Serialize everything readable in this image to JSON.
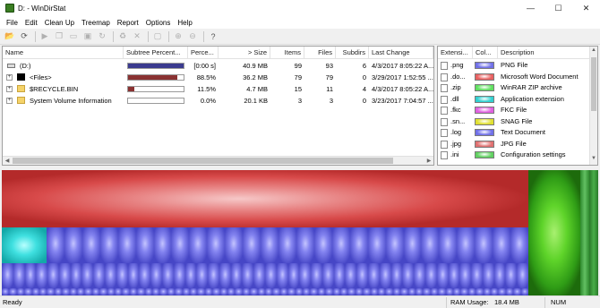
{
  "window": {
    "title": "D: - WinDirStat",
    "minimize": "—",
    "maximize": "☐",
    "close": "✕"
  },
  "menu": [
    "File",
    "Edit",
    "Clean Up",
    "Treemap",
    "Report",
    "Options",
    "Help"
  ],
  "toolbar": [
    {
      "icon": "open-folder-icon",
      "glyph": "📂",
      "enabled": true
    },
    {
      "icon": "refresh-icon",
      "glyph": "⟳",
      "enabled": true
    },
    {
      "sep": true
    },
    {
      "icon": "play-icon",
      "glyph": "▶",
      "enabled": false
    },
    {
      "icon": "copy-icon",
      "glyph": "❐",
      "enabled": false
    },
    {
      "icon": "explorer-icon",
      "glyph": "▭",
      "enabled": false
    },
    {
      "icon": "command-prompt-icon",
      "glyph": "▣",
      "enabled": false
    },
    {
      "icon": "reload-icon",
      "glyph": "↻",
      "enabled": false
    },
    {
      "sep": true
    },
    {
      "icon": "recycle-icon",
      "glyph": "♻",
      "enabled": false
    },
    {
      "icon": "delete-icon",
      "glyph": "✕",
      "enabled": false
    },
    {
      "sep": true
    },
    {
      "icon": "new-folder-icon",
      "glyph": "▢",
      "enabled": false
    },
    {
      "sep": true
    },
    {
      "icon": "zoom-in-icon",
      "glyph": "⊕",
      "enabled": false
    },
    {
      "icon": "zoom-out-icon",
      "glyph": "⊖",
      "enabled": false
    },
    {
      "sep": true
    },
    {
      "icon": "help-icon",
      "glyph": "?",
      "enabled": true
    }
  ],
  "tree": {
    "columns": [
      "Name",
      "Subtree Percent...",
      "Perce...",
      "> Size",
      "Items",
      "Files",
      "Subdirs",
      "Last Change"
    ],
    "rows": [
      {
        "name": "(D:)",
        "icon": "drive-icon",
        "expander": "",
        "subtree_fraction": 1.0,
        "subtree_color": "#3b3b8f",
        "percent": "[0:00 s]",
        "size": "40.9 MB",
        "items": "99",
        "files": "93",
        "subdirs": "6",
        "last_change": "4/3/2017  8:05:22 A..."
      },
      {
        "name": "<Files>",
        "icon": "files-icon",
        "expander": "+",
        "subtree_fraction": 0.885,
        "subtree_color": "#8a3232",
        "percent": "88.5%",
        "size": "36.2 MB",
        "items": "79",
        "files": "79",
        "subdirs": "0",
        "last_change": "3/29/2017  1:52:55 ..."
      },
      {
        "name": "$RECYCLE.BIN",
        "icon": "folder-icon",
        "expander": "+",
        "subtree_fraction": 0.115,
        "subtree_color": "#8a3232",
        "percent": "11.5%",
        "size": "4.7 MB",
        "items": "15",
        "files": "11",
        "subdirs": "4",
        "last_change": "4/3/2017  8:05:22 A..."
      },
      {
        "name": "System Volume Information",
        "icon": "folder-icon",
        "expander": "+",
        "subtree_fraction": 0.0,
        "subtree_color": "#8a3232",
        "percent": "0.0%",
        "size": "20.1 KB",
        "items": "3",
        "files": "3",
        "subdirs": "0",
        "last_change": "3/23/2017  7:04:57 ..."
      }
    ]
  },
  "extensions": {
    "columns": [
      "Extensi...",
      "Col...",
      "Description"
    ],
    "rows": [
      {
        "ext": ".png",
        "color": "#7070e8",
        "desc": "PNG File"
      },
      {
        "ext": ".do...",
        "color": "#e86060",
        "desc": "Microsoft Word Document"
      },
      {
        "ext": ".zip",
        "color": "#60e060",
        "desc": "WinRAR ZIP archive"
      },
      {
        "ext": ".dll",
        "color": "#30d0d0",
        "desc": "Application extension"
      },
      {
        "ext": ".fkc",
        "color": "#e060e0",
        "desc": "FKC File"
      },
      {
        "ext": ".sn...",
        "color": "#e0e030",
        "desc": "SNAG File"
      },
      {
        "ext": ".log",
        "color": "#7070e8",
        "desc": "Text Document"
      },
      {
        "ext": ".jpg",
        "color": "#e07070",
        "desc": "JPG File"
      },
      {
        "ext": ".ini",
        "color": "#60d060",
        "desc": "Configuration settings"
      }
    ]
  },
  "status": {
    "ready": "Ready",
    "ram_label": "RAM Usage:",
    "ram_value": "18.4 MB",
    "num": "NUM"
  }
}
